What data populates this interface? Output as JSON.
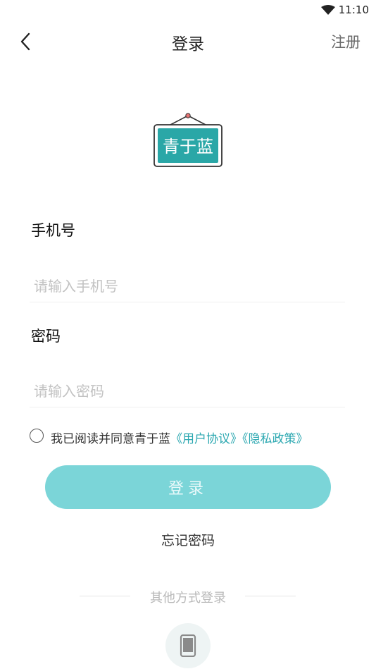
{
  "status_bar": {
    "time": "11:10"
  },
  "header": {
    "title": "登录",
    "register": "注册"
  },
  "logo": {
    "text": "青于蓝"
  },
  "form": {
    "phone_label": "手机号",
    "phone_placeholder": "请输入手机号",
    "password_label": "密码",
    "password_placeholder": "请输入密码"
  },
  "agreement": {
    "prefix": "我已阅读并同意青于蓝",
    "user_agreement": "《用户协议》",
    "privacy_policy": "《隐私政策》"
  },
  "login_button": "登录",
  "forgot_password": "忘记密码",
  "other_login": {
    "label": "其他方式登录"
  },
  "colors": {
    "accent": "#7bd5d8",
    "link": "#2aa7b0",
    "logo_teal": "#2aa7a7"
  }
}
